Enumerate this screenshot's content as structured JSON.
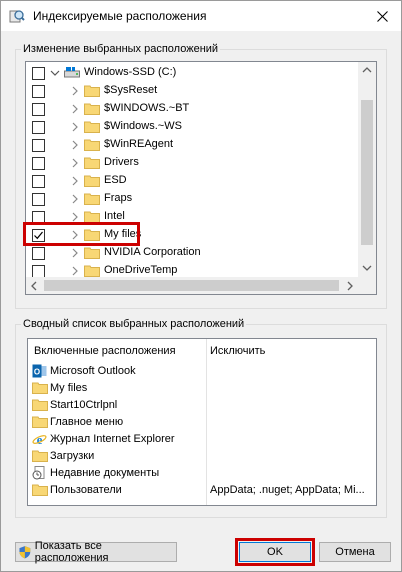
{
  "window": {
    "title": "Индексируемые расположения"
  },
  "change_group": {
    "label": "Изменение выбранных расположений"
  },
  "tree_items": [
    {
      "label": "Windows-SSD (C:)",
      "checked": false,
      "icon": "drive-icon",
      "level": 0,
      "expanded": true
    },
    {
      "label": "$SysReset",
      "checked": false,
      "icon": "folder-icon",
      "level": 1
    },
    {
      "label": "$WINDOWS.~BT",
      "checked": false,
      "icon": "folder-icon",
      "level": 1
    },
    {
      "label": "$Windows.~WS",
      "checked": false,
      "icon": "folder-icon",
      "level": 1
    },
    {
      "label": "$WinREAgent",
      "checked": false,
      "icon": "folder-icon",
      "level": 1
    },
    {
      "label": "Drivers",
      "checked": false,
      "icon": "folder-icon",
      "level": 1
    },
    {
      "label": "ESD",
      "checked": false,
      "icon": "folder-icon",
      "level": 1
    },
    {
      "label": "Fraps",
      "checked": false,
      "icon": "folder-icon",
      "level": 1
    },
    {
      "label": "Intel",
      "checked": false,
      "icon": "folder-icon",
      "level": 1
    },
    {
      "label": "My files",
      "checked": true,
      "icon": "folder-icon",
      "level": 1,
      "highlighted": true
    },
    {
      "label": "NVIDIA Corporation",
      "checked": false,
      "icon": "folder-icon",
      "level": 1
    },
    {
      "label": "OneDriveTemp",
      "checked": false,
      "icon": "folder-icon",
      "level": 1
    }
  ],
  "summary_group": {
    "label": "Сводный список выбранных расположений"
  },
  "summary": {
    "col_included": "Включенные расположения",
    "col_exclude": "Исключить",
    "rows": [
      {
        "label": "Microsoft Outlook",
        "icon": "outlook-icon",
        "exclude": ""
      },
      {
        "label": "My files",
        "icon": "folder-icon",
        "exclude": ""
      },
      {
        "label": "Start10Ctrlpnl",
        "icon": "folder-icon",
        "exclude": ""
      },
      {
        "label": "Главное меню",
        "icon": "folder-icon",
        "exclude": ""
      },
      {
        "label": "Журнал Internet Explorer",
        "icon": "ie-icon",
        "exclude": ""
      },
      {
        "label": "Загрузки",
        "icon": "folder-icon",
        "exclude": ""
      },
      {
        "label": "Недавние документы",
        "icon": "recent-docs-icon",
        "exclude": ""
      },
      {
        "label": "Пользователи",
        "icon": "folder-icon",
        "exclude": "AppData; .nuget; AppData; Mi..."
      }
    ]
  },
  "buttons": {
    "show_all": "Показать все расположения",
    "ok": "OK",
    "cancel": "Отмена"
  },
  "colors": {
    "highlight": "#cc0000",
    "folder": "#f8d775",
    "accent": "#0078d7"
  }
}
